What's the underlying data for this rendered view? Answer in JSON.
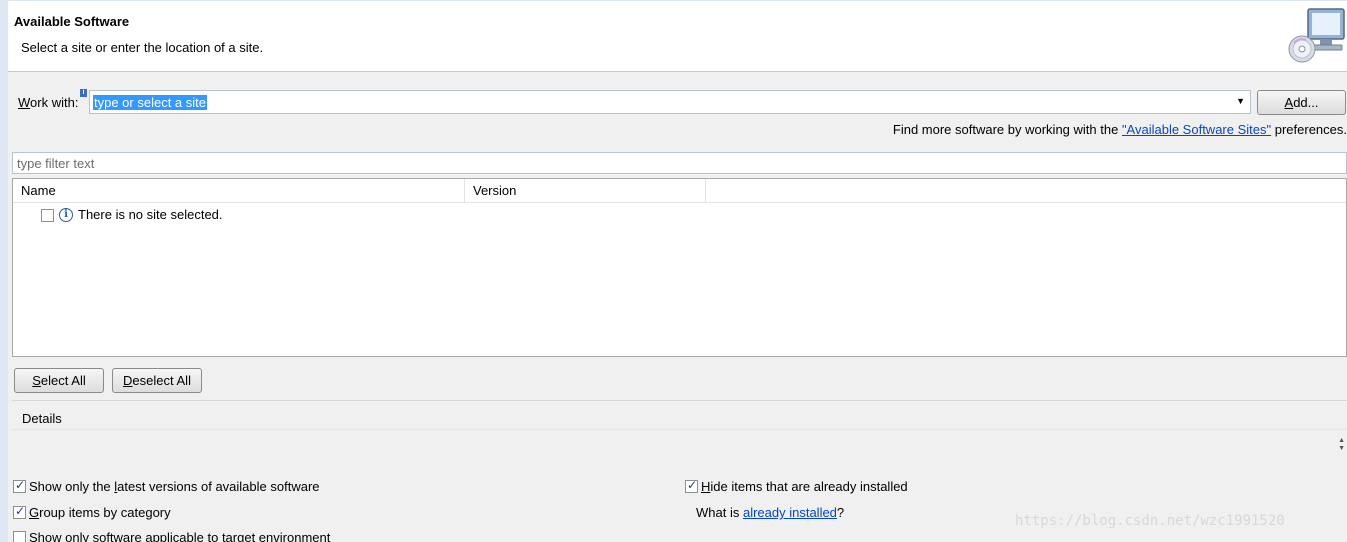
{
  "banner": {
    "title": "Available Software",
    "subtitle": "Select a site or enter the location of a site."
  },
  "work_with": {
    "label_prefix": "",
    "label_mnemonic": "W",
    "label_rest": "ork with:",
    "value": "type or select a site",
    "add_button_mnemonic": "A",
    "add_button_rest": "dd..."
  },
  "find_more": {
    "prefix": "Find more software by working with the ",
    "link": "\"Available Software Sites\"",
    "suffix": " preferences."
  },
  "filter": {
    "placeholder": "type filter text"
  },
  "tree": {
    "columns": [
      "Name",
      "Version"
    ],
    "rows": [
      {
        "text": "There is no site selected.",
        "checked": false
      }
    ]
  },
  "buttons": {
    "select_all_mnemonic": "S",
    "select_all_rest": "elect All",
    "deselect_all_mnemonic": "D",
    "deselect_all_rest": "eselect All"
  },
  "details": {
    "label": "Details"
  },
  "options": {
    "latest_pre": "Show only the ",
    "latest_mn": "l",
    "latest_post": "atest versions of available software",
    "latest_checked": true,
    "group_pre": "",
    "group_mn": "G",
    "group_post": "roup items by category",
    "group_checked": true,
    "applicable_pre": "Show only ",
    "applicable_mn": "s",
    "applicable_post": "oftware applicable to target environment",
    "applicable_checked": false,
    "hide_pre": "",
    "hide_mn": "H",
    "hide_post": "ide items that are already installed",
    "hide_checked": true,
    "what_is_prefix": "What is ",
    "what_is_link": "already installed",
    "what_is_suffix": "?"
  },
  "watermark": "https://blog.csdn.net/wzc1991520",
  "icons": {
    "banner": "computer-cd-icon",
    "info": "info-icon",
    "combo_arrow": "dropdown-arrow-icon"
  }
}
